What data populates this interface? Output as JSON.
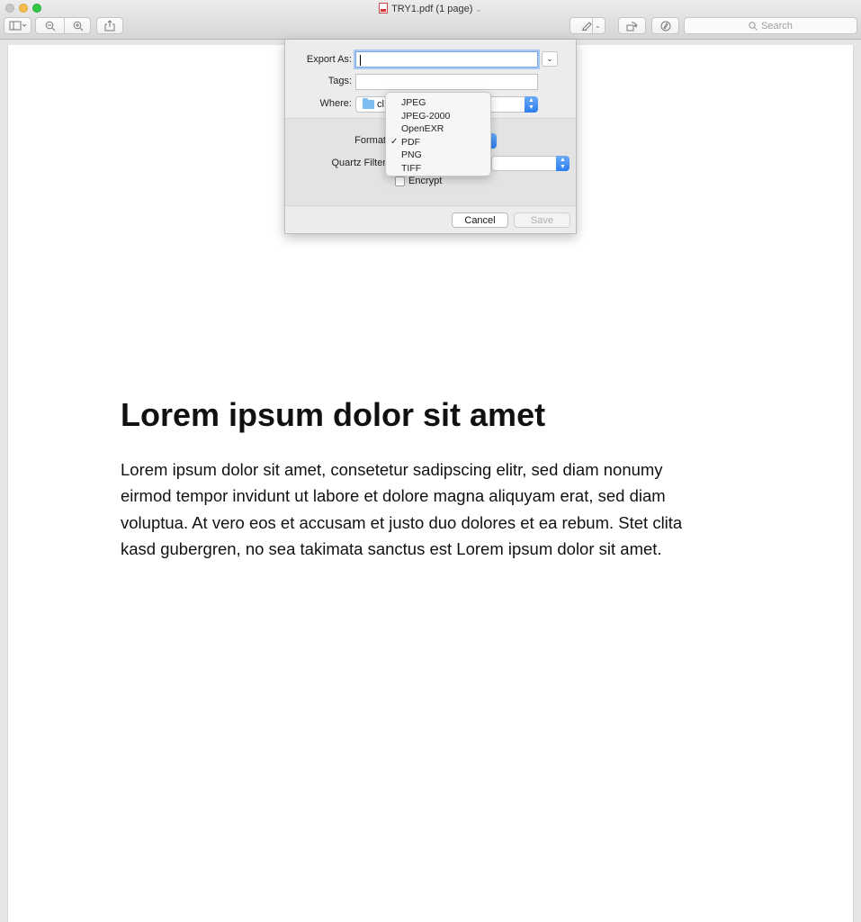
{
  "window": {
    "title": "TRY1.pdf (1 page)",
    "search_placeholder": "Search"
  },
  "toolbar": {
    "sidebar_icon": "sidebar-icon",
    "zoom_out_icon": "zoom-out-icon",
    "zoom_in_icon": "zoom-in-icon",
    "share_icon": "share-icon",
    "markup_icon": "pen-icon",
    "rotate_icon": "rotate-icon",
    "annotate_icon": "markup-circle-icon"
  },
  "export_sheet": {
    "export_as_label": "Export As:",
    "export_as_value": "",
    "tags_label": "Tags:",
    "tags_value": "",
    "where_label": "Where:",
    "where_value": "cl",
    "format_label": "Format",
    "quartz_label": "Quartz Filter",
    "encrypt_label": "Encrypt",
    "cancel_label": "Cancel",
    "save_label": "Save"
  },
  "format_menu": {
    "items": [
      "JPEG",
      "JPEG-2000",
      "OpenEXR",
      "PDF",
      "PNG",
      "TIFF"
    ],
    "selected": "PDF"
  },
  "document": {
    "heading": "Lorem ipsum dolor sit amet",
    "lines": [
      "Lorem ipsum dolor sit amet, consetetur sadipscing elitr, sed diam nonumy",
      "eirmod tempor invidunt ut labore et dolore magna aliquyam erat, sed diam",
      "voluptua. At vero eos et accusam et justo duo dolores et ea rebum. Stet clita",
      "kasd gubergren, no sea takimata sanctus est Lorem ipsum dolor sit amet."
    ]
  }
}
